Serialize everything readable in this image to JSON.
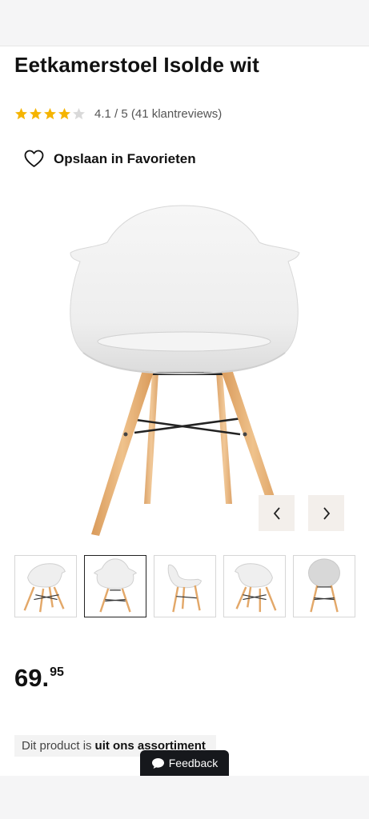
{
  "product": {
    "title": "Eetkamerstoel Isolde wit",
    "rating_text": "4.1 / 5 (41 klantreviews)",
    "rating_value": 4.1,
    "rating_max": 5,
    "star_color": "#f5b400",
    "star_empty_color": "#d9d9d9"
  },
  "favorites": {
    "label": "Opslaan in Favorieten",
    "icon": "heart-outline-icon"
  },
  "gallery": {
    "prev_icon": "chevron-left-icon",
    "next_icon": "chevron-right-icon",
    "active_thumbnail": 2,
    "thumbnails": [
      "chair-angle-left",
      "chair-front",
      "chair-side",
      "chair-angle-right",
      "chair-back"
    ]
  },
  "price": {
    "whole": "69.",
    "cents": "95"
  },
  "notice": {
    "prefix": "Dit product is",
    "bold": "uit ons assortiment"
  },
  "feedback": {
    "label": "Feedback",
    "icon": "speech-bubble-icon"
  },
  "colors": {
    "dark": "#16181c",
    "nav_bg": "#f3efeb",
    "wood": "#e9b47a"
  }
}
